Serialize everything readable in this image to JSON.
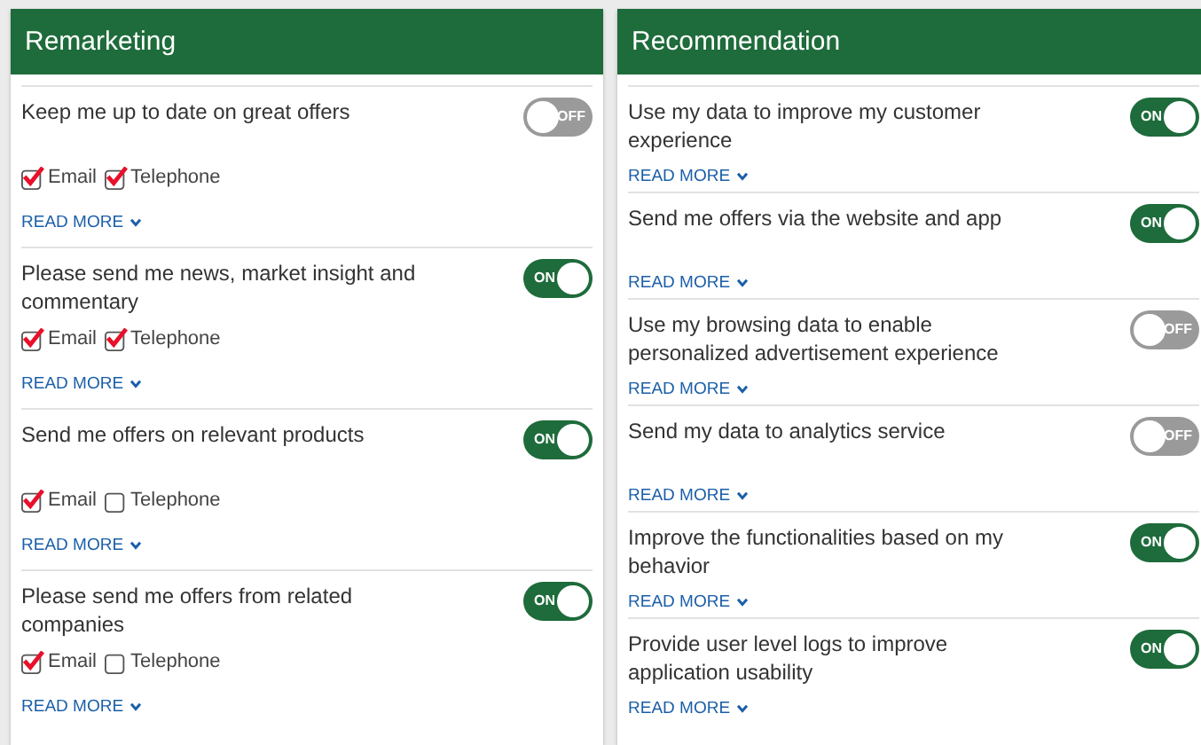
{
  "panels": [
    {
      "title": "Remarketing",
      "items": [
        {
          "text": "Keep me up to date on great offers",
          "toggle": {
            "on": false,
            "label": "OFF"
          },
          "channels": [
            {
              "label": "Email",
              "checked": true
            },
            {
              "label": "Telephone",
              "checked": true
            }
          ],
          "link": "READ MORE"
        },
        {
          "text": "Please send me news, market insight and commentary",
          "toggle": {
            "on": true,
            "label": "ON"
          },
          "channels": [
            {
              "label": "Email",
              "checked": true
            },
            {
              "label": "Telephone",
              "checked": true
            }
          ],
          "link": "READ MORE"
        },
        {
          "text": "Send me offers on relevant products",
          "toggle": {
            "on": true,
            "label": "ON"
          },
          "channels": [
            {
              "label": "Email",
              "checked": true
            },
            {
              "label": "Telephone",
              "checked": false
            }
          ],
          "link": "READ MORE"
        },
        {
          "text": "Please send me offers from related companies",
          "toggle": {
            "on": true,
            "label": "ON"
          },
          "channels": [
            {
              "label": "Email",
              "checked": true
            },
            {
              "label": "Telephone",
              "checked": false
            }
          ],
          "link": "READ MORE"
        }
      ]
    },
    {
      "title": "Recommendation",
      "items": [
        {
          "text": "Use my data to improve my customer experience",
          "toggle": {
            "on": true,
            "label": "ON"
          },
          "link": "READ MORE"
        },
        {
          "text": "Send me offers via the website and app",
          "toggle": {
            "on": true,
            "label": "ON"
          },
          "link": "READ MORE"
        },
        {
          "text": "Use my browsing data to enable personalized advertisement experience",
          "toggle": {
            "on": false,
            "label": "OFF"
          },
          "link": "READ MORE"
        },
        {
          "text": "Send my data to analytics service",
          "toggle": {
            "on": false,
            "label": "OFF"
          },
          "link": "READ MORE"
        },
        {
          "text": "Improve the functionalities based on my behavior",
          "toggle": {
            "on": true,
            "label": "ON"
          },
          "link": "READ MORE"
        },
        {
          "text": "Provide user level logs to improve application usability",
          "toggle": {
            "on": true,
            "label": "ON"
          },
          "link": "READ MORE"
        }
      ]
    }
  ]
}
